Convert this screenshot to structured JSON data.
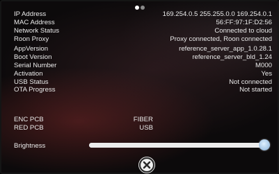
{
  "pager": {
    "total": 2,
    "active": 1
  },
  "info_rows": [
    {
      "key": "ip_address",
      "label": "IP Address",
      "value": "169.254.0.5 255.255.0.0 169.254.0.1"
    },
    {
      "key": "mac_address",
      "label": "MAC Address",
      "value": "56:FF:97:1F:D2:56"
    },
    {
      "key": "network_status",
      "label": "Network Status",
      "value": "Connected to cloud"
    },
    {
      "key": "roon_proxy",
      "label": "Roon Proxy",
      "value": "Proxy connected, Roon connected"
    },
    {
      "key": "app_version",
      "label": "AppVersion",
      "value": "reference_server_app_1.0.28.1"
    },
    {
      "key": "boot_version",
      "label": "Boot Version",
      "value": "reference_server_bld_1.24"
    },
    {
      "key": "serial_number",
      "label": "Serial Number",
      "value": "M000"
    },
    {
      "key": "activation",
      "label": "Activation",
      "value": "Yes"
    },
    {
      "key": "usb_status",
      "label": "USB Status",
      "value": "Not connected"
    },
    {
      "key": "ota_progress",
      "label": "OTA Progress",
      "value": "Not started"
    }
  ],
  "pcb_rows": [
    {
      "key": "enc_pcb",
      "label": "ENC PCB",
      "value": "FIBER"
    },
    {
      "key": "red_pcb",
      "label": "RED PCB",
      "value": "USB"
    }
  ],
  "brightness": {
    "label": "Brightness",
    "value": 0.97
  },
  "close_icon": "close-circle-icon"
}
